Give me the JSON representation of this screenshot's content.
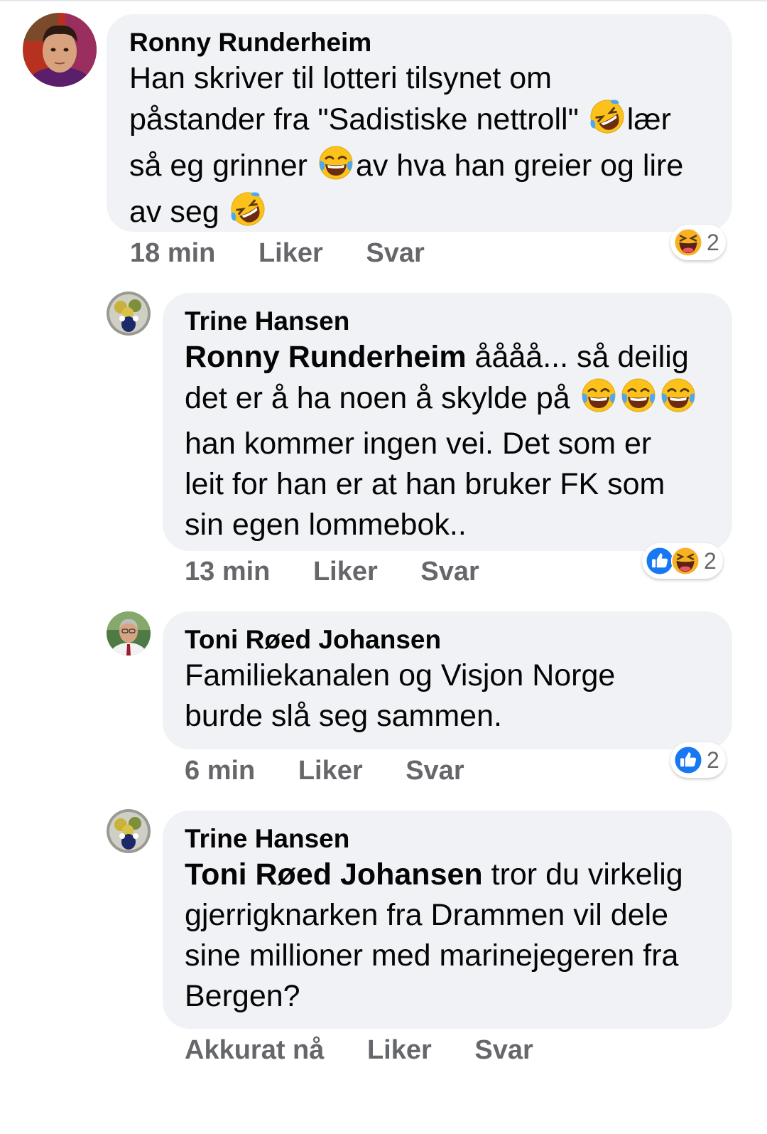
{
  "comments": [
    {
      "author": "Ronny Runderheim",
      "mention": "",
      "lines": [
        [
          "Han skriver til lotteri tilsynet om"
        ],
        [
          "påstander fra \"Sadistiske nettroll\"",
          "rofl",
          "lær"
        ],
        [
          "så eg grinner",
          "joy",
          "av hva han greier og lire"
        ],
        [
          "av seg",
          "rofl"
        ]
      ],
      "time": "18 min",
      "like_label": "Liker",
      "reply_label": "Svar",
      "reactions": [
        "haha"
      ],
      "reaction_count": "2"
    },
    {
      "author": "Trine Hansen",
      "mention": "Ronny Runderheim",
      "lines": [
        [
          "åååå... så deilig"
        ],
        [
          "det er å ha noen å skylde på",
          "joy",
          "joy",
          "joy"
        ],
        [
          "han kommer ingen vei. Det som er"
        ],
        [
          "leit for han er at han bruker FK som"
        ],
        [
          "sin egen lommebok.."
        ]
      ],
      "time": "13 min",
      "like_label": "Liker",
      "reply_label": "Svar",
      "reactions": [
        "like",
        "haha"
      ],
      "reaction_count": "2"
    },
    {
      "author": "Toni Røed Johansen",
      "mention": "",
      "lines": [
        [
          "Familiekanalen og Visjon Norge"
        ],
        [
          "burde slå seg sammen."
        ]
      ],
      "time": "6 min",
      "like_label": "Liker",
      "reply_label": "Svar",
      "reactions": [
        "like"
      ],
      "reaction_count": "2"
    },
    {
      "author": "Trine Hansen",
      "mention": "Toni Røed Johansen",
      "lines": [
        [
          "tror du virkelig"
        ],
        [
          "gjerrigknarken fra Drammen vil dele"
        ],
        [
          "sine millioner med marinejegeren fra"
        ],
        [
          "Bergen?"
        ]
      ],
      "time": "Akkurat nå",
      "like_label": "Liker",
      "reply_label": "Svar",
      "reactions": [],
      "reaction_count": ""
    }
  ],
  "colors": {
    "bubble": "#f0f2f5",
    "meta_text": "#65676b",
    "like_blue": "#1877f2",
    "emoji_yellow": "#fcc21b"
  },
  "icons": {
    "joy": "tears-of-joy-emoji-icon",
    "rofl": "rolling-on-floor-laughing-emoji-icon",
    "haha": "haha-reaction-icon",
    "like": "like-reaction-icon"
  }
}
